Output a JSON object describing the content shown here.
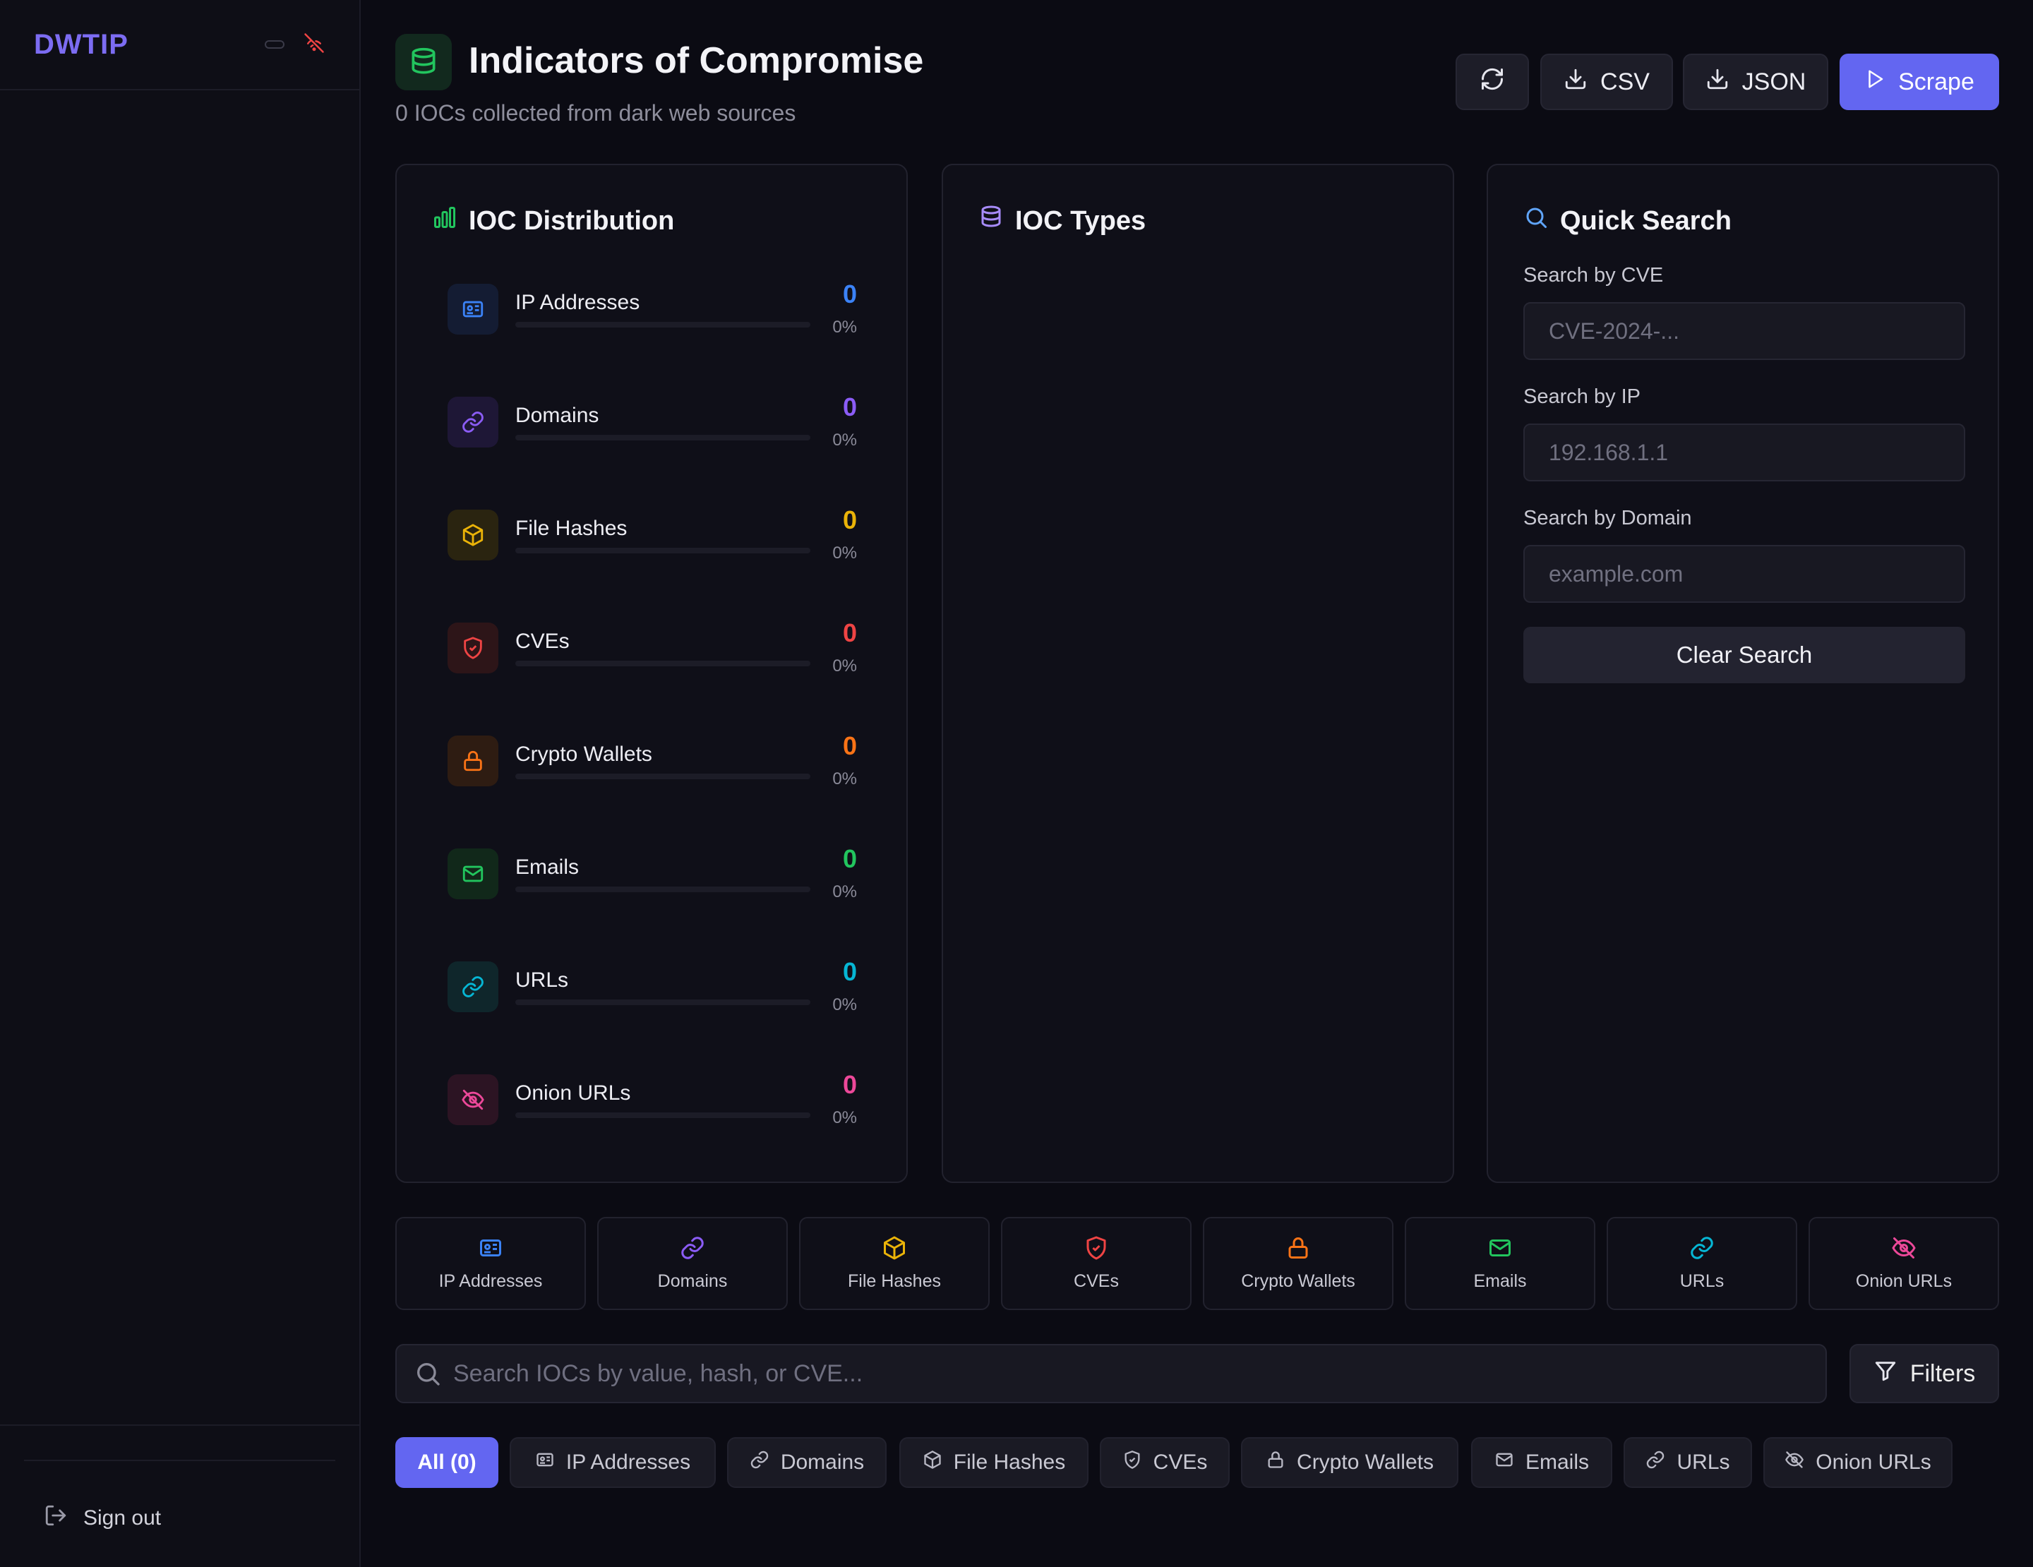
{
  "app": {
    "name": "DWTIP"
  },
  "sidebar": {
    "signout_label": "Sign out"
  },
  "header": {
    "title": "Indicators of Compromise",
    "subtitle": "0 IOCs collected from dark web sources",
    "csv_label": "CSV",
    "json_label": "JSON",
    "scrape_label": "Scrape"
  },
  "distribution": {
    "title": "IOC Distribution",
    "items": [
      {
        "label": "IP Addresses",
        "count": "0",
        "percent": "0%",
        "color": "#3b82f6"
      },
      {
        "label": "Domains",
        "count": "0",
        "percent": "0%",
        "color": "#8b5cf6"
      },
      {
        "label": "File Hashes",
        "count": "0",
        "percent": "0%",
        "color": "#eab308"
      },
      {
        "label": "CVEs",
        "count": "0",
        "percent": "0%",
        "color": "#ef4444"
      },
      {
        "label": "Crypto Wallets",
        "count": "0",
        "percent": "0%",
        "color": "#f97316"
      },
      {
        "label": "Emails",
        "count": "0",
        "percent": "0%",
        "color": "#22c55e"
      },
      {
        "label": "URLs",
        "count": "0",
        "percent": "0%",
        "color": "#06b6d4"
      },
      {
        "label": "Onion URLs",
        "count": "0",
        "percent": "0%",
        "color": "#ec4899"
      }
    ]
  },
  "types_card": {
    "title": "IOC Types"
  },
  "quick_search": {
    "title": "Quick Search",
    "cve_label": "Search by CVE",
    "cve_placeholder": "CVE-2024-...",
    "ip_label": "Search by IP",
    "ip_placeholder": "192.168.1.1",
    "domain_label": "Search by Domain",
    "domain_placeholder": "example.com",
    "clear_label": "Clear Search"
  },
  "tiles": [
    "IP Addresses",
    "Domains",
    "File Hashes",
    "CVEs",
    "Crypto Wallets",
    "Emails",
    "URLs",
    "Onion URLs"
  ],
  "search": {
    "placeholder": "Search IOCs by value, hash, or CVE...",
    "filters_label": "Filters"
  },
  "chips": [
    "All (0)",
    "IP Addresses",
    "Domains",
    "File Hashes",
    "CVEs",
    "Crypto Wallets",
    "Emails",
    "URLs",
    "Onion URLs"
  ],
  "colors": {
    "accent": "#6366f1",
    "brand": "#7c6cf2",
    "offline": "#ef4444"
  },
  "icons": [
    "database-icon",
    "refresh-icon",
    "download-icon",
    "play-icon",
    "bar-chart-icon",
    "search-icon",
    "filter-icon",
    "id-card-icon",
    "link-icon",
    "cube-icon",
    "shield-icon",
    "lock-icon",
    "mail-icon",
    "eye-off-icon",
    "logout-icon",
    "wifi-off-icon"
  ]
}
